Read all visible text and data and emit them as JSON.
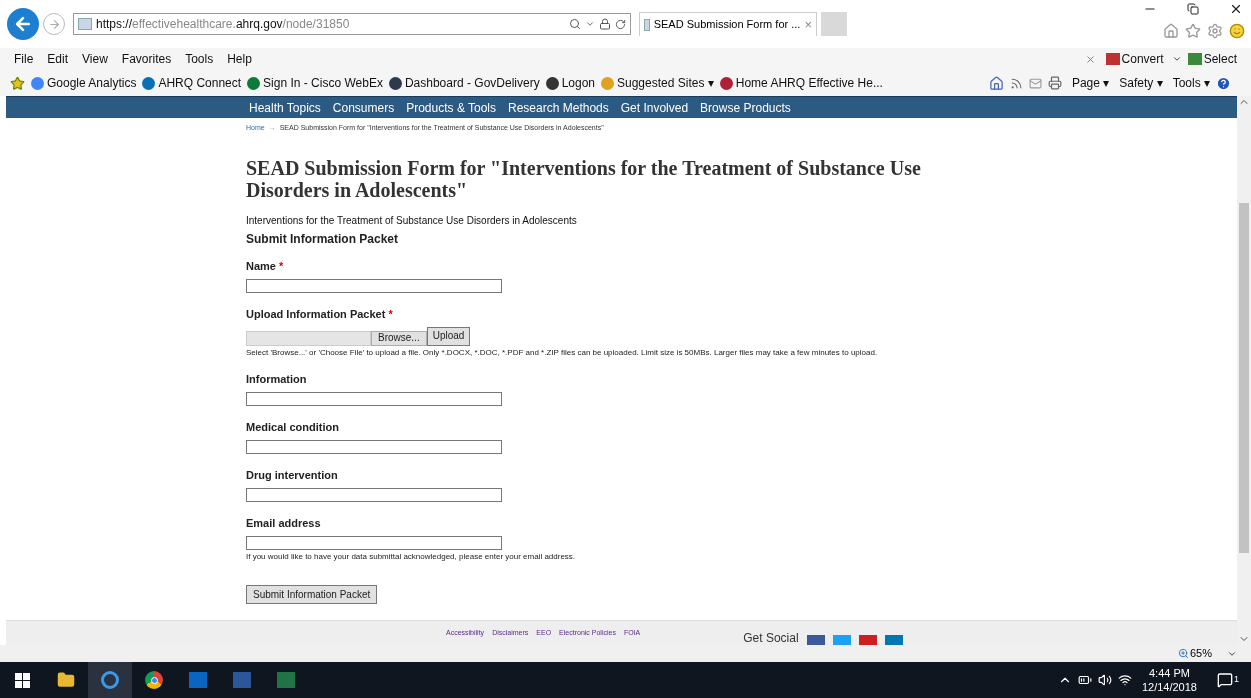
{
  "browser": {
    "url_prefix": "https://",
    "url_domain": "effectivehealthcare.",
    "url_domain_bold": "ahrq.gov",
    "url_path": "/node/31850",
    "tab_title": "SEAD Submission Form for ...",
    "tab_close": "×",
    "menu": [
      "File",
      "Edit",
      "View",
      "Favorites",
      "Tools",
      "Help"
    ],
    "convert": "Convert",
    "select": "Select",
    "favorites": [
      {
        "label": "Google Analytics",
        "color": "#4285f4"
      },
      {
        "label": "AHRQ Connect",
        "color": "#0b6fb8"
      },
      {
        "label": "Sign In - Cisco WebEx",
        "color": "#0d7a3a"
      },
      {
        "label": "Dashboard - GovDelivery",
        "color": "#2d3a4a"
      },
      {
        "label": "Logon",
        "color": "#333333"
      },
      {
        "label": "Suggested Sites ▾",
        "color": "#e0a020"
      },
      {
        "label": "Home  AHRQ Effective He...",
        "color": "#b0203a"
      }
    ],
    "command_bar": [
      "Page ▾",
      "Safety ▾",
      "Tools ▾"
    ]
  },
  "nav": [
    "Health Topics",
    "Consumers",
    "Products & Tools",
    "Research Methods",
    "Get Involved",
    "Browse Products"
  ],
  "breadcrumb": {
    "home": "Home",
    "arrow": "→",
    "current": "SEAD Submission Form for \"Interventions for the Treatment of Substance Use Disorders in Adolescents\""
  },
  "title": "SEAD Submission Form for \"Interventions for the Treatment of Substance Use Disorders in Adolescents\"",
  "subtitle": "Interventions for the Treatment of Substance Use Disorders in Adolescents",
  "section": "Submit Information Packet",
  "fields": [
    {
      "kind": "text",
      "label": "Name",
      "required": true
    },
    {
      "kind": "file",
      "label": "Upload Information Packet",
      "required": true,
      "browse": "Browse...",
      "upload": "Upload",
      "help": "Select 'Browse...' or 'Choose File' to upload a file. Only *.DOCX, *.DOC, *.PDF and *.ZIP files can be uploaded. Limit size is 50MBs. Larger files may take a few minutes to upload."
    },
    {
      "kind": "text",
      "label": "Information",
      "required": false
    },
    {
      "kind": "text",
      "label": "Medical condition",
      "required": false
    },
    {
      "kind": "text",
      "label": "Drug intervention",
      "required": false
    },
    {
      "kind": "text",
      "label": "Email address",
      "required": false,
      "help": "If you would like to have your data submittal acknowledged, please enter your email address."
    }
  ],
  "required_mark": "*",
  "submit": "Submit Information Packet",
  "footer": {
    "links": [
      "Accessibility",
      "Disclaimers",
      "EEO",
      "Electronic Policies",
      "FOIA"
    ],
    "social": "Get Social"
  },
  "status": {
    "zoom": "65%"
  },
  "taskbar": {
    "time": "4:44 PM",
    "date": "12/14/2018",
    "notifications": "1"
  }
}
